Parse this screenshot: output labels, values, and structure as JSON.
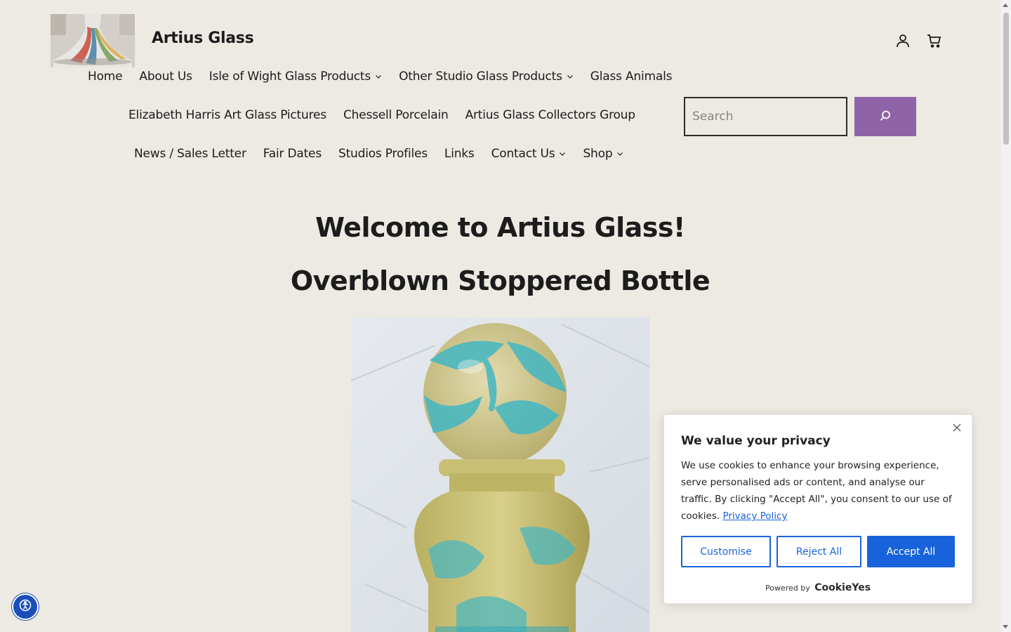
{
  "site": {
    "title": "Artius Glass"
  },
  "nav": {
    "row1": [
      {
        "label": "Home",
        "dropdown": false
      },
      {
        "label": "About Us",
        "dropdown": false
      },
      {
        "label": "Isle of Wight Glass Products",
        "dropdown": true
      },
      {
        "label": "Other Studio Glass Products",
        "dropdown": true
      },
      {
        "label": "Glass Animals",
        "dropdown": false
      }
    ],
    "row2": [
      {
        "label": "Elizabeth Harris Art Glass Pictures",
        "dropdown": false
      },
      {
        "label": "Chessell Porcelain",
        "dropdown": false
      },
      {
        "label": "Artius Glass Collectors Group",
        "dropdown": false
      }
    ],
    "row3": [
      {
        "label": "News / Sales Letter",
        "dropdown": false
      },
      {
        "label": "Fair Dates",
        "dropdown": false
      },
      {
        "label": "Studios Profiles",
        "dropdown": false
      },
      {
        "label": "Links",
        "dropdown": false
      },
      {
        "label": "Contact Us",
        "dropdown": true
      },
      {
        "label": "Shop",
        "dropdown": true
      }
    ]
  },
  "search": {
    "placeholder": "Search",
    "value": ""
  },
  "header_icons": [
    "account-icon",
    "cart-icon",
    "search-icon"
  ],
  "main": {
    "heading": "Welcome to Artius Glass!",
    "subheading": "Overblown Stoppered Bottle"
  },
  "cookie_banner": {
    "title": "We value your privacy",
    "text": "We use cookies to enhance your browsing experience, serve personalised ads or content, and analyse our traffic. By clicking \"Accept All\", you consent to our use of cookies.",
    "link": "Privacy Policy",
    "customise": "Customise",
    "reject": "Reject All",
    "accept": "Accept All",
    "powered_by": "Powered by",
    "brand": "CookieYes"
  },
  "colors": {
    "background": "#ede9e3",
    "search_button": "#8f63a8",
    "cookie_accent": "#1863dc",
    "a11y_button": "#1a4fba"
  }
}
